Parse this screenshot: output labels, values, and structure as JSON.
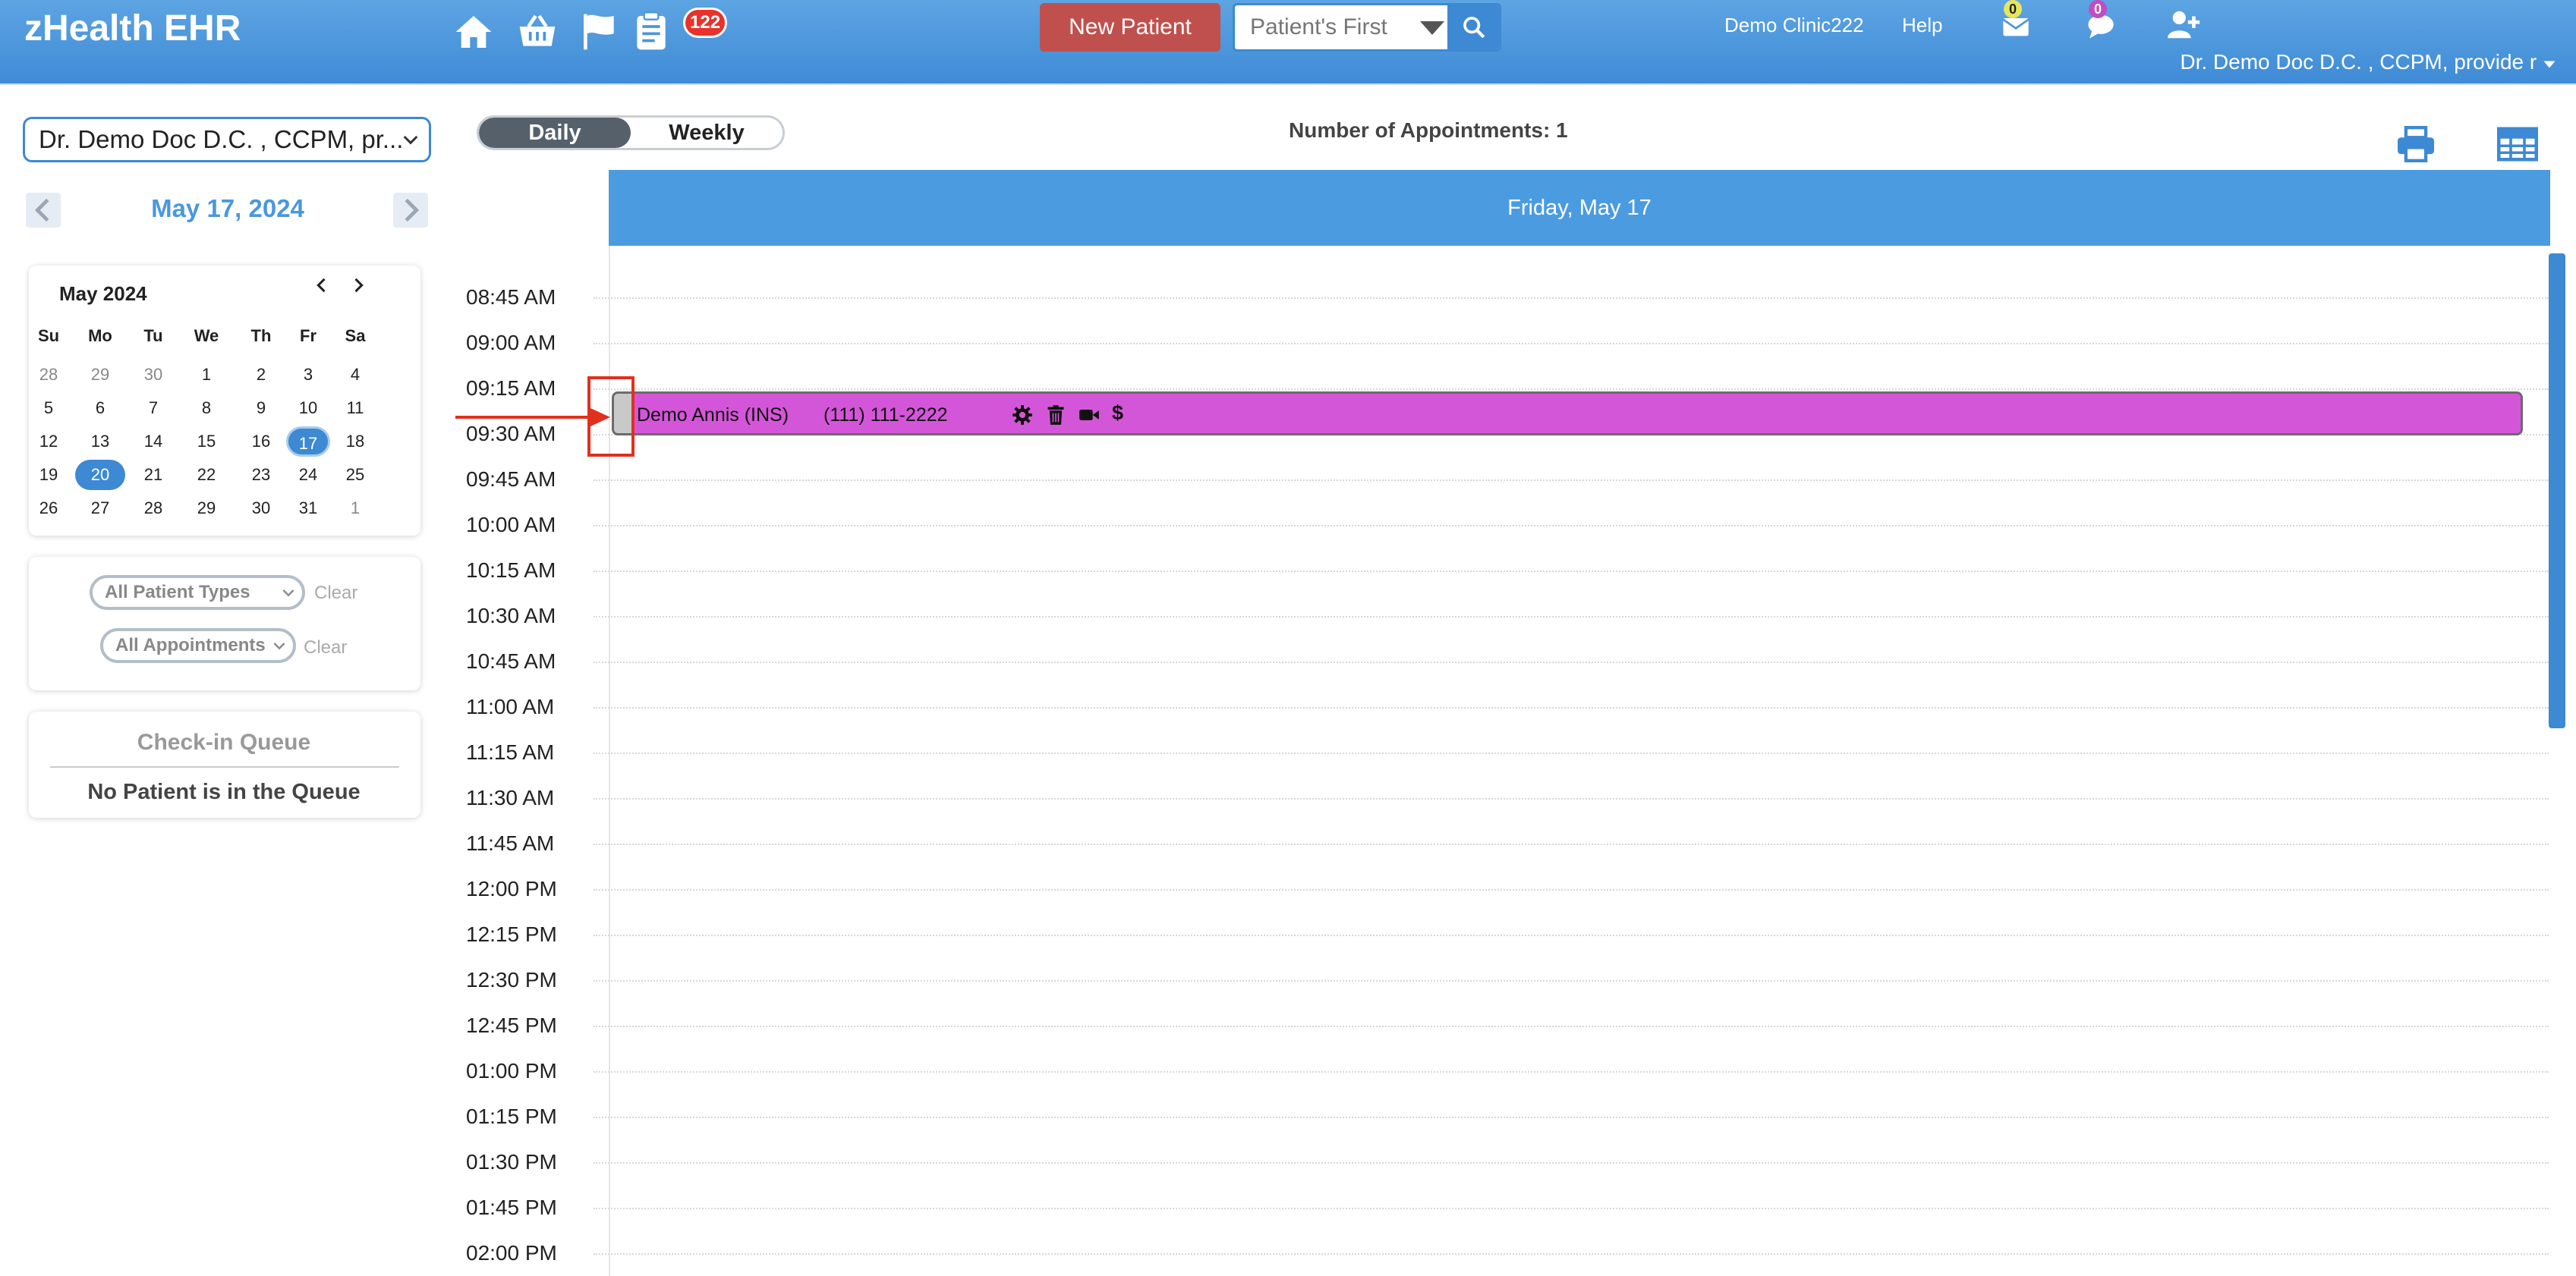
{
  "app": {
    "title": "zHealth EHR"
  },
  "header": {
    "notifications_count": "122",
    "new_patient_label": "New Patient",
    "search_placeholder": "Patient's First",
    "clinic_name": "Demo Clinic222",
    "help_label": "Help",
    "mail_count": "0",
    "chat_count": "0",
    "user_name": "Dr. Demo Doc D.C. , CCPM, provide r",
    "icons": [
      "home-icon",
      "basket-icon",
      "flag-icon",
      "clipboard-icon",
      "mail-icon",
      "chat-icon",
      "add-user-icon",
      "search-icon"
    ]
  },
  "sidebar": {
    "provider_select": "Dr. Demo Doc D.C. , CCPM, pr...",
    "current_date": "May 17, 2024",
    "mini_calendar": {
      "month_label": "May 2024",
      "weekdays": [
        "Su",
        "Mo",
        "Tu",
        "We",
        "Th",
        "Fr",
        "Sa"
      ],
      "weeks": [
        [
          "28",
          "29",
          "30",
          "1",
          "2",
          "3",
          "4"
        ],
        [
          "5",
          "6",
          "7",
          "8",
          "9",
          "10",
          "11"
        ],
        [
          "12",
          "13",
          "14",
          "15",
          "16",
          "17",
          "18"
        ],
        [
          "19",
          "20",
          "21",
          "22",
          "23",
          "24",
          "25"
        ],
        [
          "26",
          "27",
          "28",
          "29",
          "30",
          "31",
          "1"
        ]
      ],
      "selected_day": "17",
      "today_day": "20"
    },
    "filters": {
      "patient_types": "All Patient Types",
      "appointments": "All Appointments",
      "clear_label": "Clear"
    },
    "queue": {
      "title": "Check-in Queue",
      "empty_message": "No Patient is in the Queue"
    }
  },
  "main": {
    "view_toggle": {
      "daily": "Daily",
      "weekly": "Weekly",
      "active": "Daily"
    },
    "appointment_count": "Number of Appointments: 1",
    "day_header": "Friday, May 17",
    "time_slots": [
      "08:45 AM",
      "09:00 AM",
      "09:15 AM",
      "09:30 AM",
      "09:45 AM",
      "10:00 AM",
      "10:15 AM",
      "10:30 AM",
      "10:45 AM",
      "11:00 AM",
      "11:15 AM",
      "11:30 AM",
      "11:45 AM",
      "12:00 PM",
      "12:15 PM",
      "12:30 PM",
      "12:45 PM",
      "01:00 PM",
      "01:15 PM",
      "01:30 PM",
      "01:45 PM",
      "02:00 PM"
    ],
    "appointment": {
      "patient": "Demo Annis (INS)",
      "phone": "(111) 111-2222",
      "color": "#d456d8",
      "actions": [
        "gear-icon",
        "trash-icon",
        "video-icon",
        "dollar-icon"
      ],
      "dollar_label": "$"
    }
  },
  "colors": {
    "header_blue": "#3f8bd6",
    "accent_blue": "#3d89d3",
    "new_patient_red": "#c0504d",
    "annotation_red": "#e0301e"
  }
}
